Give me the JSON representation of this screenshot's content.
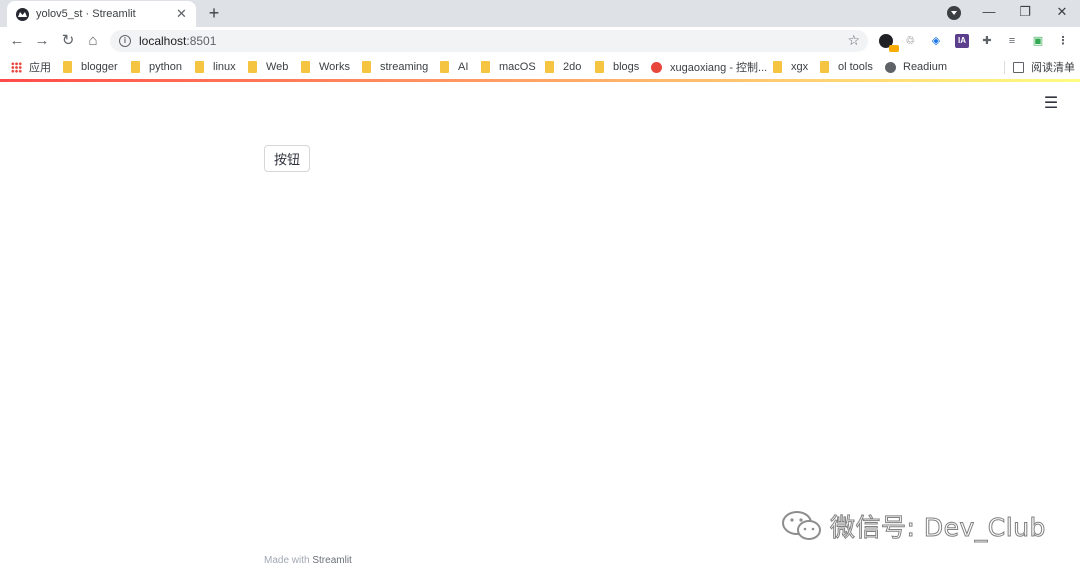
{
  "browser": {
    "tab": {
      "title": "yolov5_st · Streamlit",
      "close": "✕"
    },
    "new_tab": "+",
    "window_controls": {
      "minimize": "—",
      "restore": "❐",
      "close": "✕"
    },
    "address": {
      "host": "localhost",
      "port": ":8501"
    },
    "bookmarks": [
      "应用",
      "blogger",
      "python",
      "linux",
      "Web",
      "Works",
      "streaming",
      "AI",
      "macOS",
      "2do",
      "blogs",
      "xugaoxiang - 控制...",
      "xgx",
      "ol tools",
      "Readium"
    ],
    "reading_list": "阅读清单"
  },
  "app": {
    "menu_icon": "☰",
    "button_label": "按钮",
    "footer": {
      "prefix": "Made with",
      "brand": "Streamlit"
    }
  },
  "watermark": {
    "text": "微信号: Dev_Club"
  },
  "colors": {
    "accent_start": "#ff4b4b",
    "accent_end": "#fffd80",
    "tabstrip": "#dee1e6",
    "omnibox": "#f1f3f4"
  }
}
